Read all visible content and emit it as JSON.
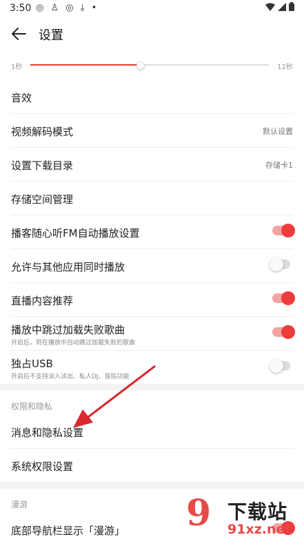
{
  "status_bar": {
    "time": "3:50",
    "left_icons": [
      "netease-icon",
      "qq-icon",
      "netease-icon",
      "download-icon",
      "dot-icon"
    ],
    "right_icons": [
      "wifi-icon",
      "signal-icon",
      "battery-icon"
    ]
  },
  "header": {
    "title": "设置",
    "back_icon": "arrow-left-icon"
  },
  "slider": {
    "min_label": "1秒",
    "max_label": "12秒",
    "fraction": 0.46,
    "accent": "#e53935"
  },
  "settings": [
    {
      "label": "音效"
    },
    {
      "label": "视频解码模式",
      "value": "默认设置"
    },
    {
      "label": "设置下载目录",
      "value": "存储卡1"
    },
    {
      "label": "存储空间管理"
    },
    {
      "label": "播客随心听FM自动播放设置",
      "toggle": true
    },
    {
      "label": "允许与其他应用同时播放",
      "toggle": false
    },
    {
      "label": "直播内容推荐",
      "toggle": true
    },
    {
      "label": "播放中跳过加载失败歌曲",
      "sub": "开启后，则在播放中自动跳过加载失败的歌曲",
      "toggle": true
    },
    {
      "label": "独占USB",
      "sub": "开启后不支持淡入淡出、私人DJ、音贴功能",
      "toggle": false
    }
  ],
  "privacy_section": {
    "title": "权限和隐私",
    "items": [
      {
        "label": "消息和隐私设置"
      },
      {
        "label": "系统权限设置"
      }
    ]
  },
  "roam_section": {
    "title": "漫游",
    "items": [
      {
        "label": "底部导航栏显示「漫游」",
        "toggle": true
      }
    ]
  },
  "watermark": {
    "title": "下载站",
    "url": "91xz.net"
  },
  "colors": {
    "accent": "#ee3b3b",
    "arrow": "#d9282f"
  }
}
